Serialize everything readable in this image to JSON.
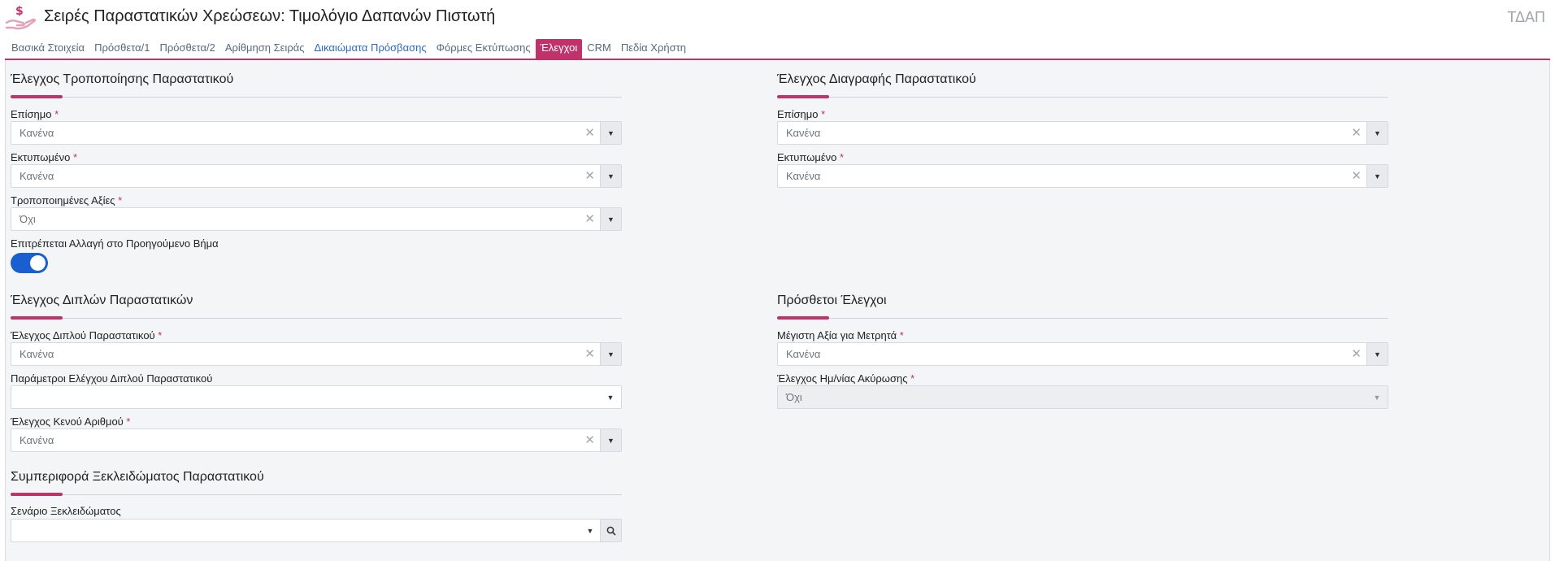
{
  "header": {
    "title": "Σειρές Παραστατικών Χρεώσεων: Τιμολόγιο Δαπανών Πιστωτή",
    "code": "ΤΔΑΠ",
    "logo_icon": "hand-dollar-icon",
    "accent_color": "#c0336a"
  },
  "tabs": [
    {
      "label": "Βασικά Στοιχεία"
    },
    {
      "label": "Πρόσθετα/1"
    },
    {
      "label": "Πρόσθετα/2"
    },
    {
      "label": "Αρίθμηση Σειράς"
    },
    {
      "label": "Δικαιώματα Πρόσβασης"
    },
    {
      "label": "Φόρμες Εκτύπωσης"
    },
    {
      "label": "Έλεγχοι"
    },
    {
      "label": "CRM"
    },
    {
      "label": "Πεδία Χρήστη"
    }
  ],
  "active_tab": "Έλεγχοι",
  "required_mark": "*",
  "modify": {
    "title": "Έλεγχος Τροποποίησης Παραστατικού",
    "official_label": "Επίσημο",
    "official_value": "Κανένα",
    "printed_label": "Εκτυπωμένο",
    "printed_value": "Κανένα",
    "modified_values_label": "Τροποποιημένες Αξίες",
    "modified_values_value": "Όχι",
    "allow_change_label": "Επιτρέπεται Αλλαγή στο Προηγούμενο Βήμα",
    "allow_change_on": true
  },
  "delete": {
    "title": "Έλεγχος Διαγραφής Παραστατικού",
    "official_label": "Επίσημο",
    "official_value": "Κανένα",
    "printed_label": "Εκτυπωμένο",
    "printed_value": "Κανένα"
  },
  "duplicates": {
    "title": "Έλεγχος Διπλών Παραστατικών",
    "dup_check_label": "Έλεγχος Διπλού Παραστατικού",
    "dup_check_value": "Κανένα",
    "dup_params_label": "Παράμετροι Ελέγχου Διπλού Παραστατικού",
    "dup_params_value": "",
    "gap_check_label": "Έλεγχος Κενού Αριθμού",
    "gap_check_value": "Κανένα"
  },
  "extra": {
    "title": "Πρόσθετοι Έλεγχοι",
    "max_cash_label": "Μέγιστη Αξία για Μετρητά",
    "max_cash_value": "Κανένα",
    "cancel_date_label": "Έλεγχος Ημ/νίας Ακύρωσης",
    "cancel_date_value": "Όχι"
  },
  "unlock": {
    "title": "Συμπεριφορά Ξεκλειδώματος Παραστατικού",
    "scenario_label": "Σενάριο Ξεκλειδώματος",
    "scenario_value": ""
  }
}
